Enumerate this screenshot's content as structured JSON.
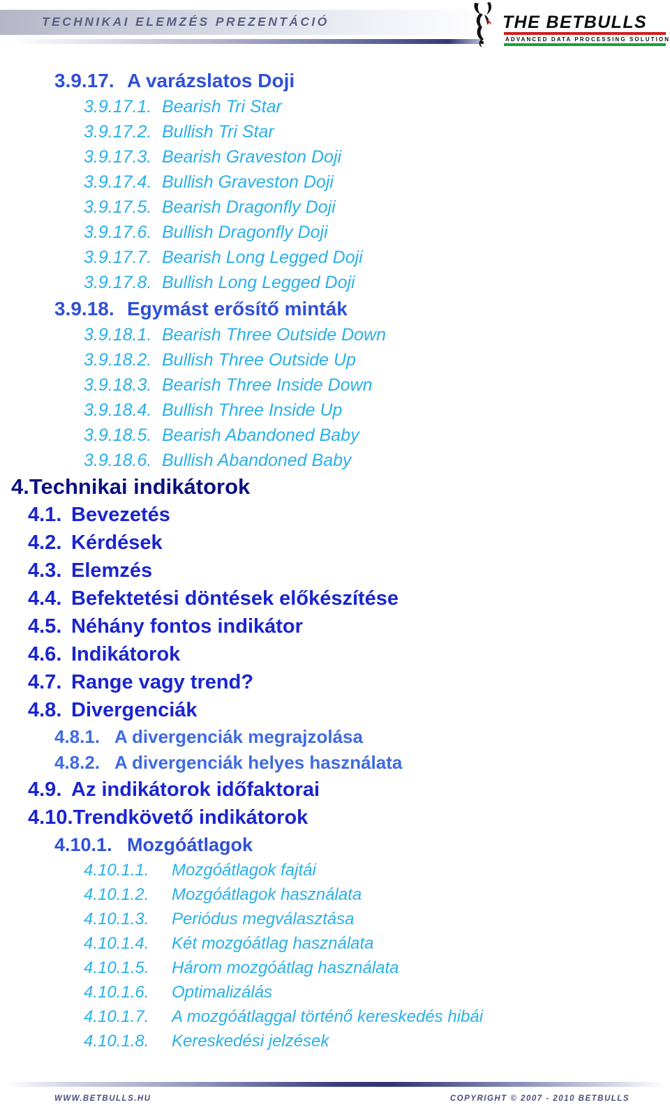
{
  "header": {
    "title": "TECHNIKAI ELEMZÉS PREZENTÁCIÓ",
    "logo": {
      "wordmark": "THE BETBULLS",
      "tagline": "ADVANCED DATA PROCESSING SOLUTIONS",
      "bar_red": "#cf1f1f",
      "bar_green": "#16a336"
    }
  },
  "colors": {
    "level1": "#0a1080",
    "level2": "#1a25cf",
    "level3": "#3f6ae2",
    "level4": "#29b0e8",
    "header_title": "#5a5f84",
    "footer_text": "#4a4f7e",
    "rule_navy": "#343876"
  },
  "toc": {
    "entries": [
      {
        "level": 2,
        "num": "3.9.17.",
        "text": "A varázslatos Doji"
      },
      {
        "level": 4,
        "num": "3.9.17.1.",
        "text": "Bearish Tri Star"
      },
      {
        "level": 4,
        "num": "3.9.17.2.",
        "text": "Bullish Tri Star"
      },
      {
        "level": 4,
        "num": "3.9.17.3.",
        "text": "Bearish Graveston Doji"
      },
      {
        "level": 4,
        "num": "3.9.17.4.",
        "text": "Bullish Graveston Doji"
      },
      {
        "level": 4,
        "num": "3.9.17.5.",
        "text": "Bearish Dragonfly Doji"
      },
      {
        "level": 4,
        "num": "3.9.17.6.",
        "text": "Bullish Dragonfly Doji"
      },
      {
        "level": 4,
        "num": "3.9.17.7.",
        "text": "Bearish Long Legged Doji"
      },
      {
        "level": 4,
        "num": "3.9.17.8.",
        "text": "Bullish Long Legged Doji"
      },
      {
        "level": 2,
        "num": "3.9.18.",
        "text": "Egymást erősítő minták"
      },
      {
        "level": 4,
        "num": "3.9.18.1.",
        "text": "Bearish Three Outside Down"
      },
      {
        "level": 4,
        "num": "3.9.18.2.",
        "text": "Bullish Three Outside Up"
      },
      {
        "level": 4,
        "num": "3.9.18.3.",
        "text": "Bearish Three Inside Down"
      },
      {
        "level": 4,
        "num": "3.9.18.4.",
        "text": "Bullish Three Inside Up"
      },
      {
        "level": 4,
        "num": "3.9.18.5.",
        "text": "Bearish Abandoned Baby"
      },
      {
        "level": 4,
        "num": "3.9.18.6.",
        "text": "Bullish Abandoned Baby"
      },
      {
        "level": 1,
        "num": "4.",
        "text": "Technikai indikátorok"
      },
      {
        "level": 21,
        "num": "4.1.",
        "text": "Bevezetés"
      },
      {
        "level": 21,
        "num": "4.2.",
        "text": "Kérdések"
      },
      {
        "level": 21,
        "num": "4.3.",
        "text": "Elemzés"
      },
      {
        "level": 21,
        "num": "4.4.",
        "text": "Befektetési döntések előkészítése"
      },
      {
        "level": 21,
        "num": "4.5.",
        "text": "Néhány fontos indikátor"
      },
      {
        "level": 21,
        "num": "4.6.",
        "text": "Indikátorok"
      },
      {
        "level": 21,
        "num": "4.7.",
        "text": "Range vagy trend?"
      },
      {
        "level": 21,
        "num": "4.8.",
        "text": "Divergenciák"
      },
      {
        "level": 3,
        "num": "4.8.1.",
        "text": "A divergenciák megrajzolása"
      },
      {
        "level": 3,
        "num": "4.8.2.",
        "text": "A divergenciák helyes használata"
      },
      {
        "level": 21,
        "num": "4.9.",
        "text": "Az indikátorok időfaktorai"
      },
      {
        "level": 21,
        "num": "4.10.",
        "text": "Trendkövető indikátorok"
      },
      {
        "level": 31,
        "num": "4.10.1.",
        "text": "Mozgóátlagok"
      },
      {
        "level": 41,
        "num": "4.10.1.1.",
        "text": "Mozgóátlagok fajtái"
      },
      {
        "level": 41,
        "num": "4.10.1.2.",
        "text": "Mozgóátlagok használata"
      },
      {
        "level": 41,
        "num": "4.10.1.3.",
        "text": "Periódus megválasztása"
      },
      {
        "level": 41,
        "num": "4.10.1.4.",
        "text": "Két mozgóátlag használata"
      },
      {
        "level": 41,
        "num": "4.10.1.5.",
        "text": "Három mozgóátlag használata"
      },
      {
        "level": 41,
        "num": "4.10.1.6.",
        "text": "Optimalizálás"
      },
      {
        "level": 41,
        "num": "4.10.1.7.",
        "text": "A mozgóátlaggal történő kereskedés hibái"
      },
      {
        "level": 41,
        "num": "4.10.1.8.",
        "text": "Kereskedési jelzések"
      }
    ]
  },
  "footer": {
    "site": "WWW.BETBULLS.HU",
    "copyright": "COPYRIGHT © 2007 - 2010 BETBULLS"
  }
}
